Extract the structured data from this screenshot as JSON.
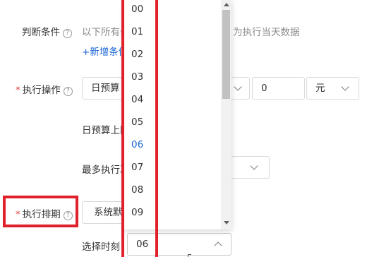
{
  "condition": {
    "label": "判断条件",
    "help": "?",
    "text_left": "以下所有条",
    "text_right": "为执行当天数据",
    "add_condition": "+新增条件"
  },
  "action": {
    "label": "执行操作",
    "help": "?",
    "select_value": "日预算",
    "amount_value": "0",
    "unit_value": "元",
    "budget_limit_label": "日预算上限",
    "max_exec_label": "最多执行次"
  },
  "schedule": {
    "label": "执行排期",
    "help": "?",
    "select_value": "系统默认",
    "time_label": "选择时刻",
    "time_value": "06"
  },
  "required_mark": "*",
  "dropdown": {
    "options": [
      "00",
      "01",
      "02",
      "03",
      "04",
      "05",
      "06",
      "07",
      "08",
      "09"
    ],
    "selected": "06"
  },
  "colors": {
    "accent": "#1a66d6",
    "highlight_box": "#e0202a",
    "required": "#e0483f"
  }
}
